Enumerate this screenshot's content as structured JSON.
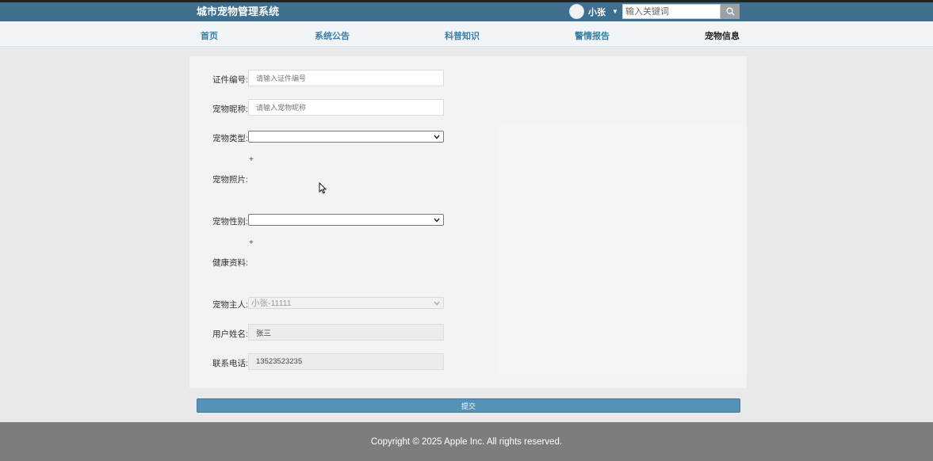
{
  "header": {
    "title": "城市宠物管理系统",
    "user": {
      "name": "小张"
    },
    "search": {
      "placeholder": "输入关键词"
    }
  },
  "nav": {
    "items": [
      {
        "label": "首页"
      },
      {
        "label": "系统公告"
      },
      {
        "label": "科普知识"
      },
      {
        "label": "警情报告"
      },
      {
        "label": "宠物信息"
      }
    ],
    "active": "宠物信息"
  },
  "form": {
    "cert_label": "证件编号:",
    "cert_placeholder": "请输入证件编号",
    "nickname_label": "宠物昵称:",
    "nickname_placeholder": "请输入宠物昵称",
    "type_label": "宠物类型:",
    "type_value": "",
    "photo_label": "宠物照片:",
    "photo_plus": "+",
    "gender_label": "宠物性别:",
    "gender_value": "",
    "health_label": "健康资料:",
    "health_plus": "+",
    "owner_label": "宠物主人:",
    "owner_value": "小张-11111",
    "realname_label": "用户姓名:",
    "realname_value": "张三",
    "phone_label": "联系电话:",
    "phone_value": "13523523235",
    "submit_label": "提交"
  },
  "footer": {
    "copyright": "Copyright © 2025 Apple Inc. All rights reserved."
  },
  "colors": {
    "header_bg": "#3f6f8f",
    "nav_link": "#3c7ca6",
    "submit_bg": "#5592b8",
    "footer_bg": "#7d7d7d"
  }
}
